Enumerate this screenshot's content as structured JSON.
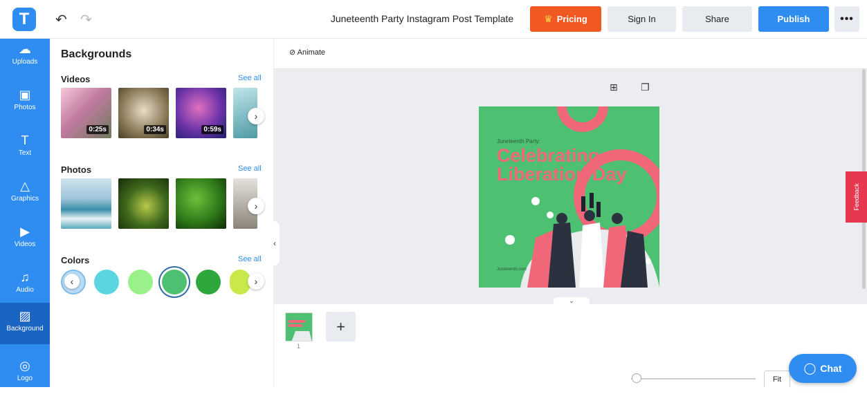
{
  "app": {
    "logo_letter": "T"
  },
  "header": {
    "document_title": "Juneteenth Party Instagram Post Template",
    "pricing_label": "Pricing",
    "signin_label": "Sign In",
    "share_label": "Share",
    "publish_label": "Publish",
    "more_label": "•••"
  },
  "rail": {
    "items": [
      {
        "label": "Uploads",
        "icon": "upload-icon"
      },
      {
        "label": "Photos",
        "icon": "photo-icon"
      },
      {
        "label": "Text",
        "icon": "text-icon"
      },
      {
        "label": "Graphics",
        "icon": "graphics-icon"
      },
      {
        "label": "Videos",
        "icon": "video-icon"
      },
      {
        "label": "Audio",
        "icon": "music-icon"
      },
      {
        "label": "Background",
        "icon": "background-icon"
      },
      {
        "label": "Logo",
        "icon": "logo-icon"
      }
    ],
    "active": "Background"
  },
  "panel": {
    "title": "Backgrounds",
    "videos": {
      "title": "Videos",
      "see_all": "See all",
      "durations": [
        "0:25s",
        "0:34s",
        "0:59s"
      ]
    },
    "photos": {
      "title": "Photos",
      "see_all": "See all"
    },
    "colors": {
      "title": "Colors",
      "see_all": "See all",
      "swatches": [
        "#b8dcf5",
        "#5bd6e0",
        "#9af08a",
        "#4ec072",
        "#2ea83c",
        "#c9e94a"
      ]
    }
  },
  "toolbar": {
    "animate_label": "Animate"
  },
  "design": {
    "small_text": "Juneteenth Party:",
    "headline": "Celebrating Liberation Day",
    "footer_text": "Juneteenth.com",
    "background_color": "#4ec072",
    "accent_color": "#f0677a"
  },
  "feedback_label": "Feedback",
  "pages": {
    "current": "1",
    "add_label": "+"
  },
  "zoom": {
    "fit_label": "Fit"
  },
  "chat": {
    "label": "Chat"
  }
}
